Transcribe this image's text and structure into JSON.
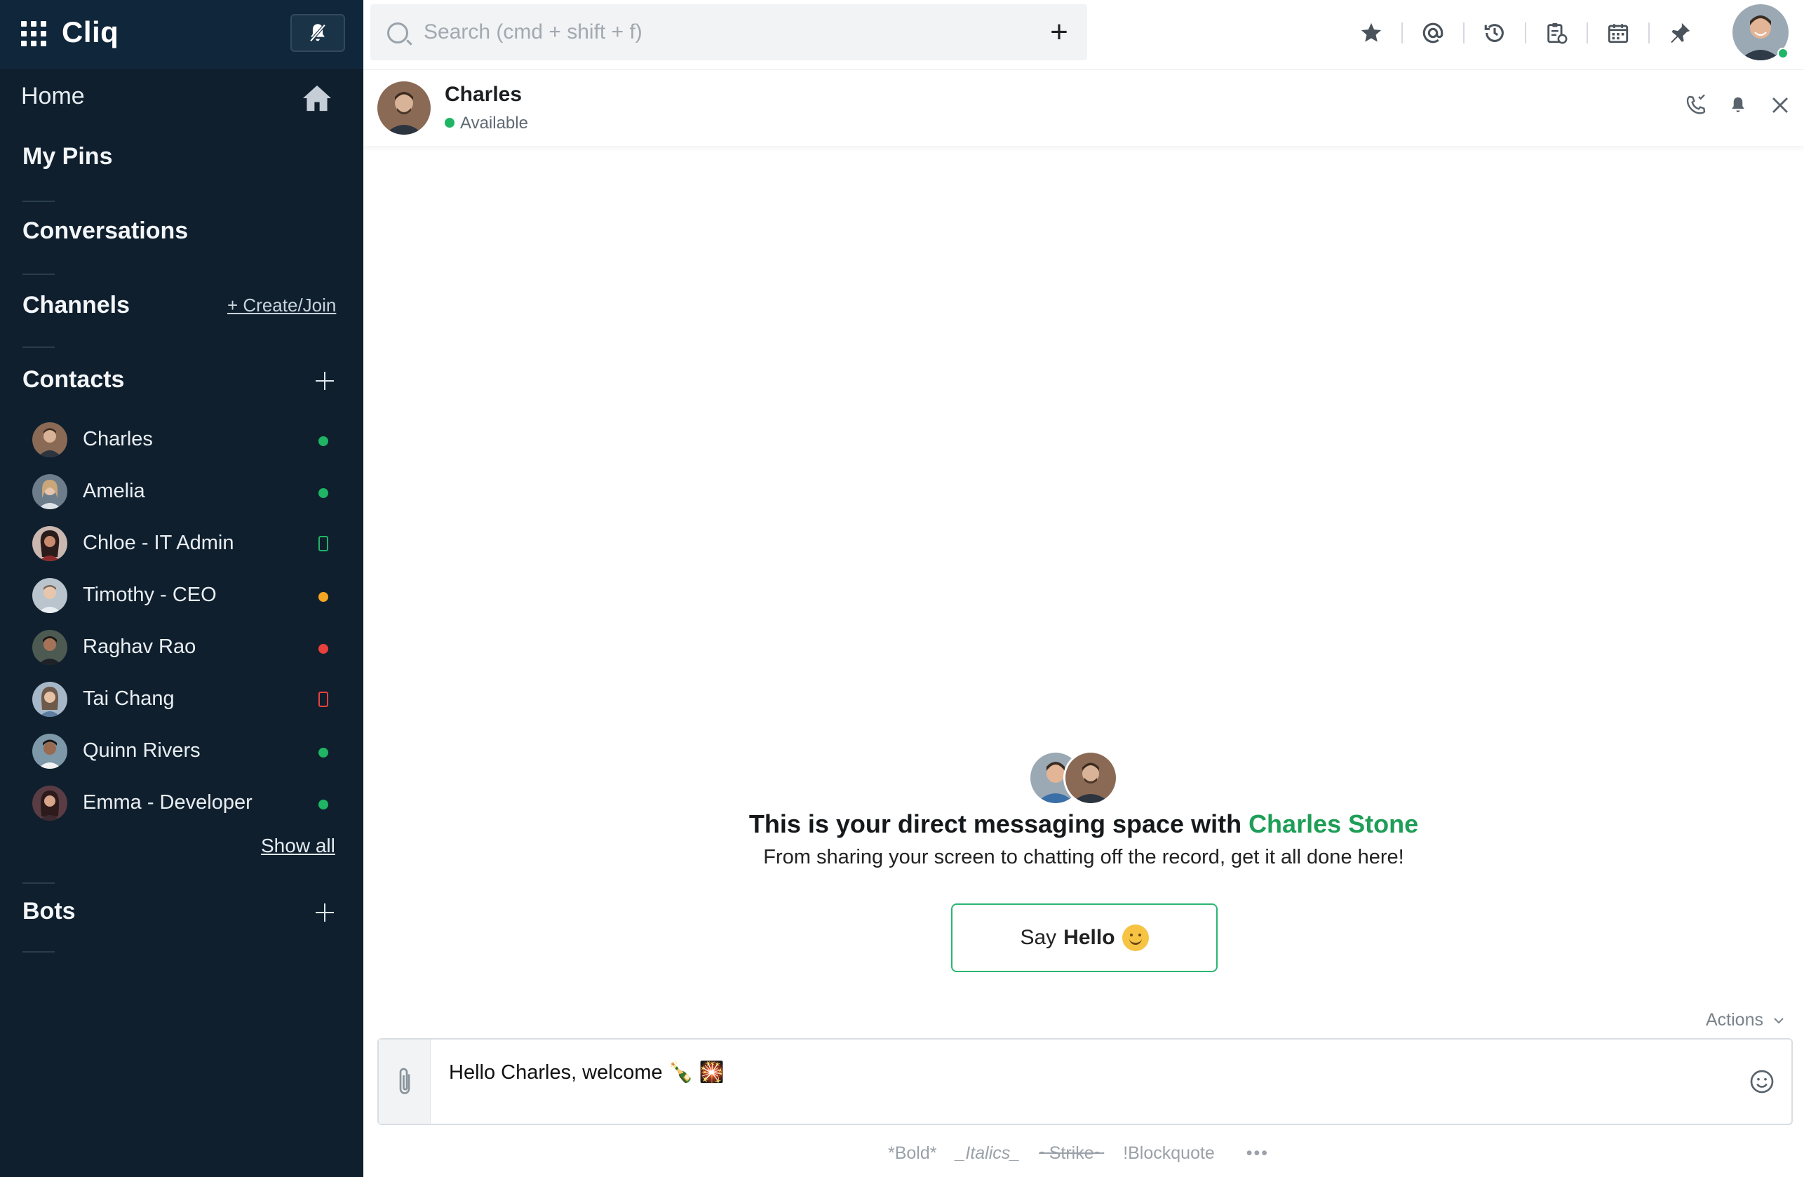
{
  "app": {
    "name": "Cliq"
  },
  "sidebar": {
    "home": "Home",
    "my_pins": "My Pins",
    "conversations": "Conversations",
    "channels": "Channels",
    "create_join": "+ Create/Join",
    "contacts": "Contacts",
    "bots": "Bots",
    "show_all": "Show all",
    "contact_list": [
      {
        "name": "Charles",
        "status": "available",
        "status_color": "#1fb565"
      },
      {
        "name": "Amelia",
        "status": "available",
        "status_color": "#1fb565"
      },
      {
        "name": "Chloe - IT Admin",
        "status": "mobile",
        "status_color": "#1fb565"
      },
      {
        "name": "Timothy - CEO",
        "status": "away",
        "status_color": "#f5a623"
      },
      {
        "name": "Raghav Rao",
        "status": "busy",
        "status_color": "#e8413c"
      },
      {
        "name": "Tai Chang",
        "status": "mobile-busy",
        "status_color": "#e8413c"
      },
      {
        "name": "Quinn Rivers",
        "status": "available",
        "status_color": "#1fb565"
      },
      {
        "name": "Emma - Developer",
        "status": "available",
        "status_color": "#1fb565"
      }
    ]
  },
  "topbar": {
    "search_placeholder": "Search (cmd + shift + f)",
    "icons": [
      "star-icon",
      "mention-icon",
      "history-icon",
      "clipboard-icon",
      "calendar-icon",
      "pin-icon"
    ]
  },
  "chat": {
    "name": "Charles",
    "status": "Available"
  },
  "welcome": {
    "title_prefix": "This is your direct messaging space with ",
    "title_name": "Charles Stone",
    "subtitle": "From sharing your screen to chatting off the record, get it all done here!",
    "say_label": "Say",
    "hello_label": "Hello"
  },
  "composer": {
    "actions_label": "Actions",
    "text": "Hello Charles, welcome 🍾 🎇"
  },
  "format_hints": {
    "bold": "*Bold*",
    "italics": "_Italics_",
    "strike": "~Strike~",
    "blockquote": "!Blockquote",
    "more": "•••"
  },
  "colors": {
    "sidebar_bg": "#0f1f2d",
    "accent_green": "#1e9e57",
    "button_border": "#2bb673"
  }
}
